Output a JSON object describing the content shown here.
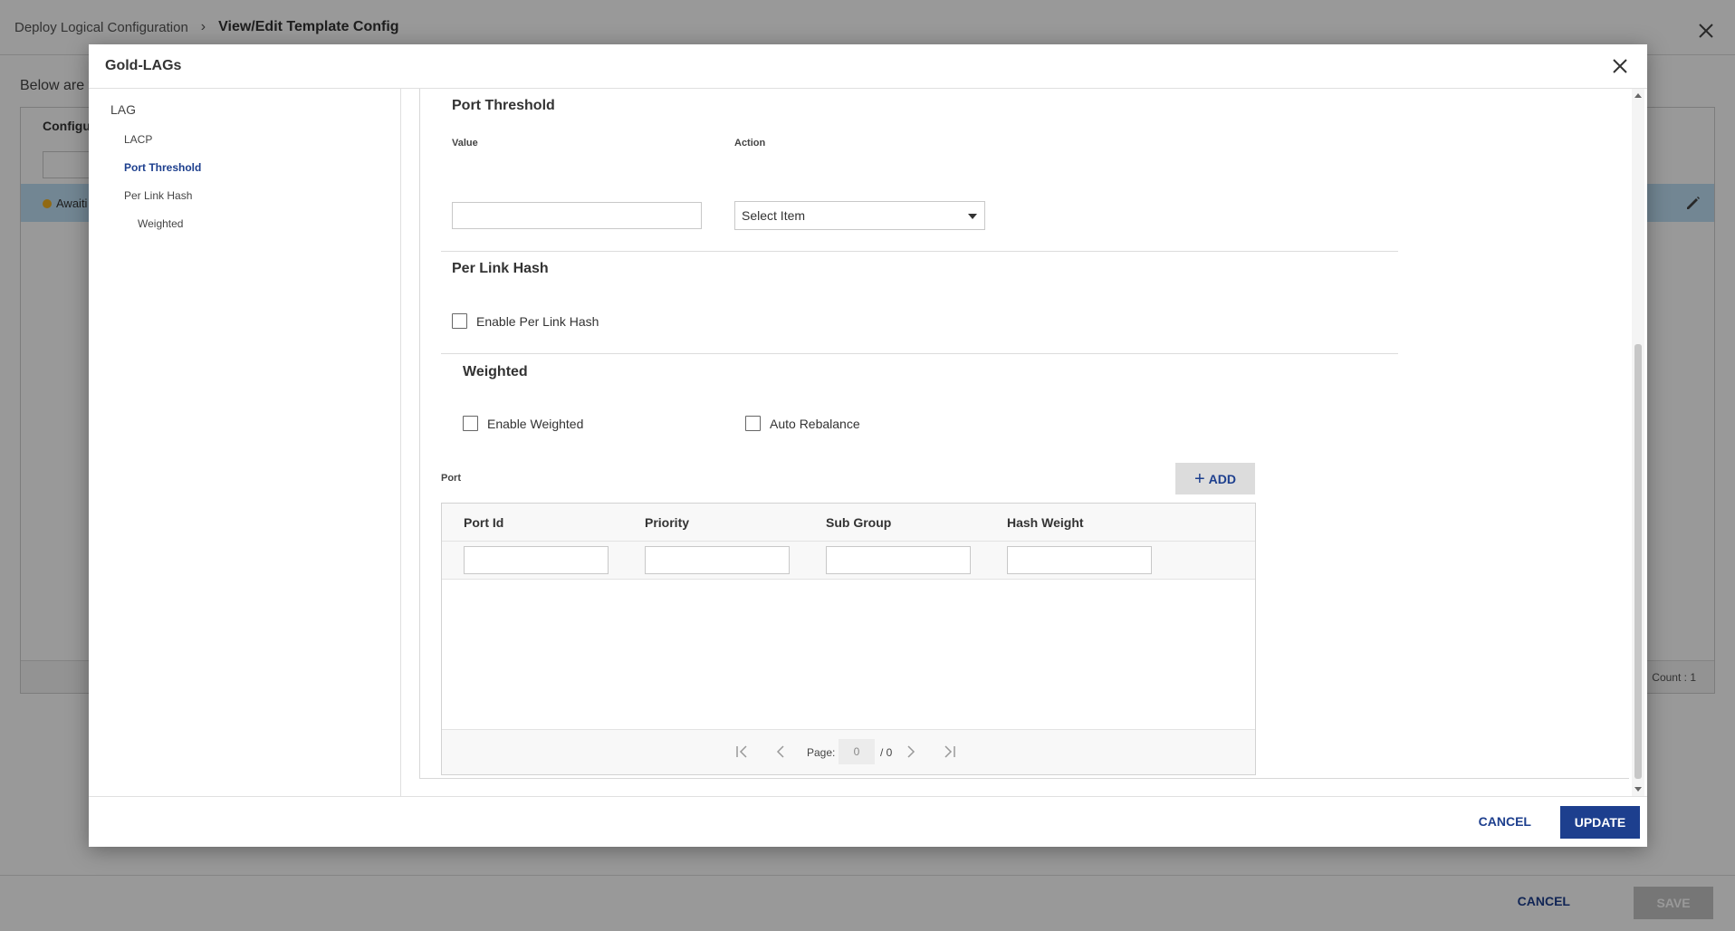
{
  "background": {
    "breadcrumb": {
      "parent": "Deploy Logical Configuration",
      "current": "View/Edit Template Config"
    },
    "intro_text": "Below are t",
    "table_header": "Configu",
    "row_status": "Awaiti",
    "count_text": "Count : 1",
    "cancel_label": "CANCEL",
    "save_label": "SAVE"
  },
  "modal": {
    "title": "Gold-LAGs",
    "nav": {
      "items": [
        {
          "label": "LAG"
        },
        {
          "label": "LACP"
        },
        {
          "label": "Port Threshold",
          "active": true
        },
        {
          "label": "Per Link Hash"
        },
        {
          "label": "Weighted"
        }
      ]
    },
    "port_threshold": {
      "title": "Port Threshold",
      "value_label": "Value",
      "value": "",
      "action_label": "Action",
      "action_selected": "Select Item"
    },
    "per_link_hash": {
      "title": "Per Link Hash",
      "enable_label": "Enable Per Link Hash"
    },
    "weighted": {
      "title": "Weighted",
      "enable_label": "Enable Weighted",
      "auto_rebalance_label": "Auto Rebalance"
    },
    "port": {
      "label": "Port",
      "add_label": "ADD",
      "columns": [
        "Port Id",
        "Priority",
        "Sub Group",
        "Hash Weight"
      ],
      "pager": {
        "page_label": "Page:",
        "page_value": "0",
        "total": "/ 0"
      }
    },
    "footer": {
      "cancel_label": "CANCEL",
      "update_label": "UPDATE"
    }
  },
  "colors": {
    "accent": "#1d3f8e",
    "status_dot": "#f2b01e",
    "selected_row": "#bfe0f6"
  }
}
